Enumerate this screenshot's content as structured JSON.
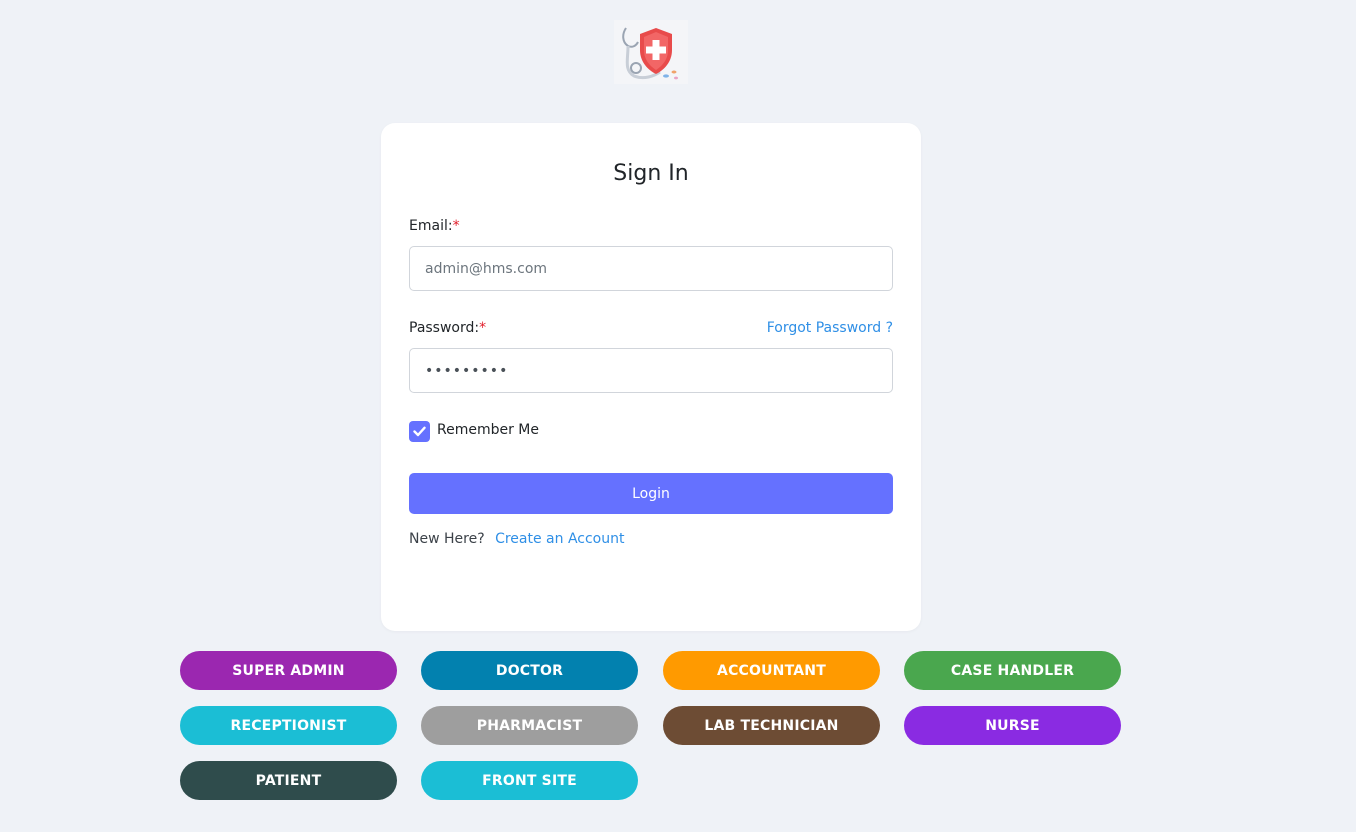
{
  "form": {
    "title": "Sign In",
    "email_label": "Email:",
    "email_placeholder": "admin@hms.com",
    "password_label": "Password:",
    "password_value": "•••••••••",
    "required_mark": "*",
    "forgot_link": "Forgot Password ?",
    "remember_label": "Remember Me",
    "remember_checked": true,
    "login_label": "Login",
    "new_here_text": "New Here?",
    "create_account_link": "Create an Account"
  },
  "colors": {
    "primary": "#6571ff",
    "link": "#2f8fe6",
    "background": "#eff2f7"
  },
  "roles": [
    {
      "label": "SUPER ADMIN",
      "color": "#9b27b0"
    },
    {
      "label": "DOCTOR",
      "color": "#0281af"
    },
    {
      "label": "ACCOUNTANT",
      "color": "#ff9a00"
    },
    {
      "label": "CASE HANDLER",
      "color": "#4aa74e"
    },
    {
      "label": "RECEPTIONIST",
      "color": "#1bbed5"
    },
    {
      "label": "PHARMACIST",
      "color": "#9e9e9e"
    },
    {
      "label": "LAB TECHNICIAN",
      "color": "#6d4c34"
    },
    {
      "label": "NURSE",
      "color": "#8a2be2"
    },
    {
      "label": "PATIENT",
      "color": "#2f4c4c"
    },
    {
      "label": "FRONT SITE",
      "color": "#1bbed5"
    }
  ],
  "icons": {
    "logo": "medical-shield-icon",
    "check": "checkmark-icon"
  }
}
